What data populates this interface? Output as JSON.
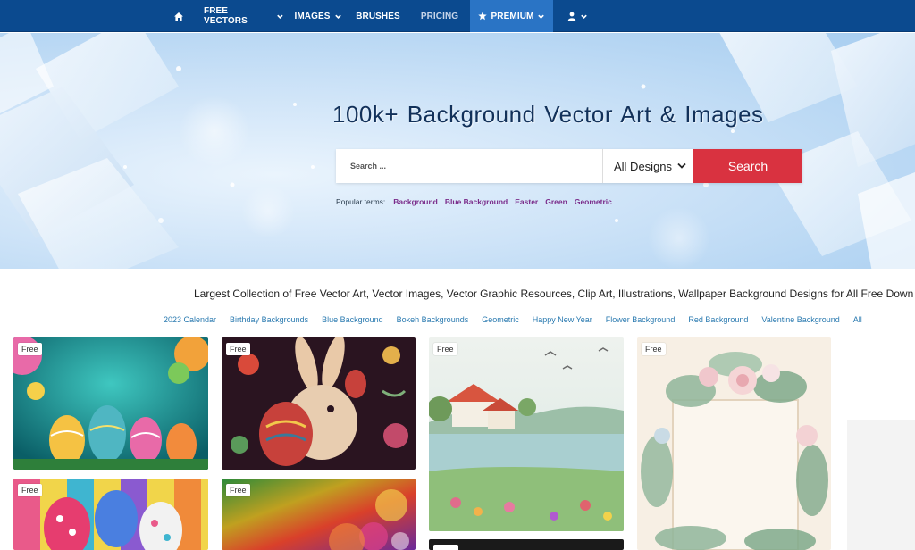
{
  "nav": {
    "items": [
      {
        "label": "",
        "icon": "home-icon"
      },
      {
        "label": "FREE VECTORS"
      },
      {
        "label": "IMAGES"
      },
      {
        "label": "BRUSHES"
      },
      {
        "label": "PRICING"
      },
      {
        "label": "PREMIUM",
        "icon": "star-icon"
      },
      {
        "label": "",
        "icon": "user-icon"
      }
    ]
  },
  "hero": {
    "title": "100k+ Background Vector Art & Images",
    "search": {
      "placeholder": "Search ...",
      "value": "",
      "select_value": "All Designs",
      "button_label": "Search"
    },
    "popular_label": "Popular terms:",
    "popular_terms": [
      "Background",
      "Blue Background",
      "Easter",
      "Green",
      "Geometric"
    ]
  },
  "tagline": "Largest Collection of Free Vector Art, Vector Images, Vector Graphic Resources, Clip Art, Illustrations, Wallpaper Background Designs for All Free Down",
  "tags": [
    "2023 Calendar",
    "Birthday Backgrounds",
    "Blue Background",
    "Bokeh Backgrounds",
    "Geometric",
    "Happy New Year",
    "Flower Background",
    "Red Background",
    "Valentine Background",
    "All"
  ],
  "cards": [
    {
      "badge": "Free",
      "subject": "easter-eggs-teal"
    },
    {
      "badge": "Free",
      "subject": "folk-art-bunny"
    },
    {
      "badge": "Free",
      "subject": "watercolor-cottage-lake"
    },
    {
      "badge": "Free",
      "subject": "floral-wreath-frame"
    },
    {
      "badge": "Free",
      "subject": "striped-easter-eggs"
    },
    {
      "badge": "Free",
      "subject": "rainbow-bokeh-eggs"
    },
    {
      "badge": "",
      "subject": "dark-card"
    }
  ],
  "colors": {
    "nav_bg": "#0b4a8f",
    "nav_active": "#2a74c5",
    "search_button": "#d93240",
    "popular_term": "#7a2c8a",
    "tag_link": "#2a7ab0"
  }
}
